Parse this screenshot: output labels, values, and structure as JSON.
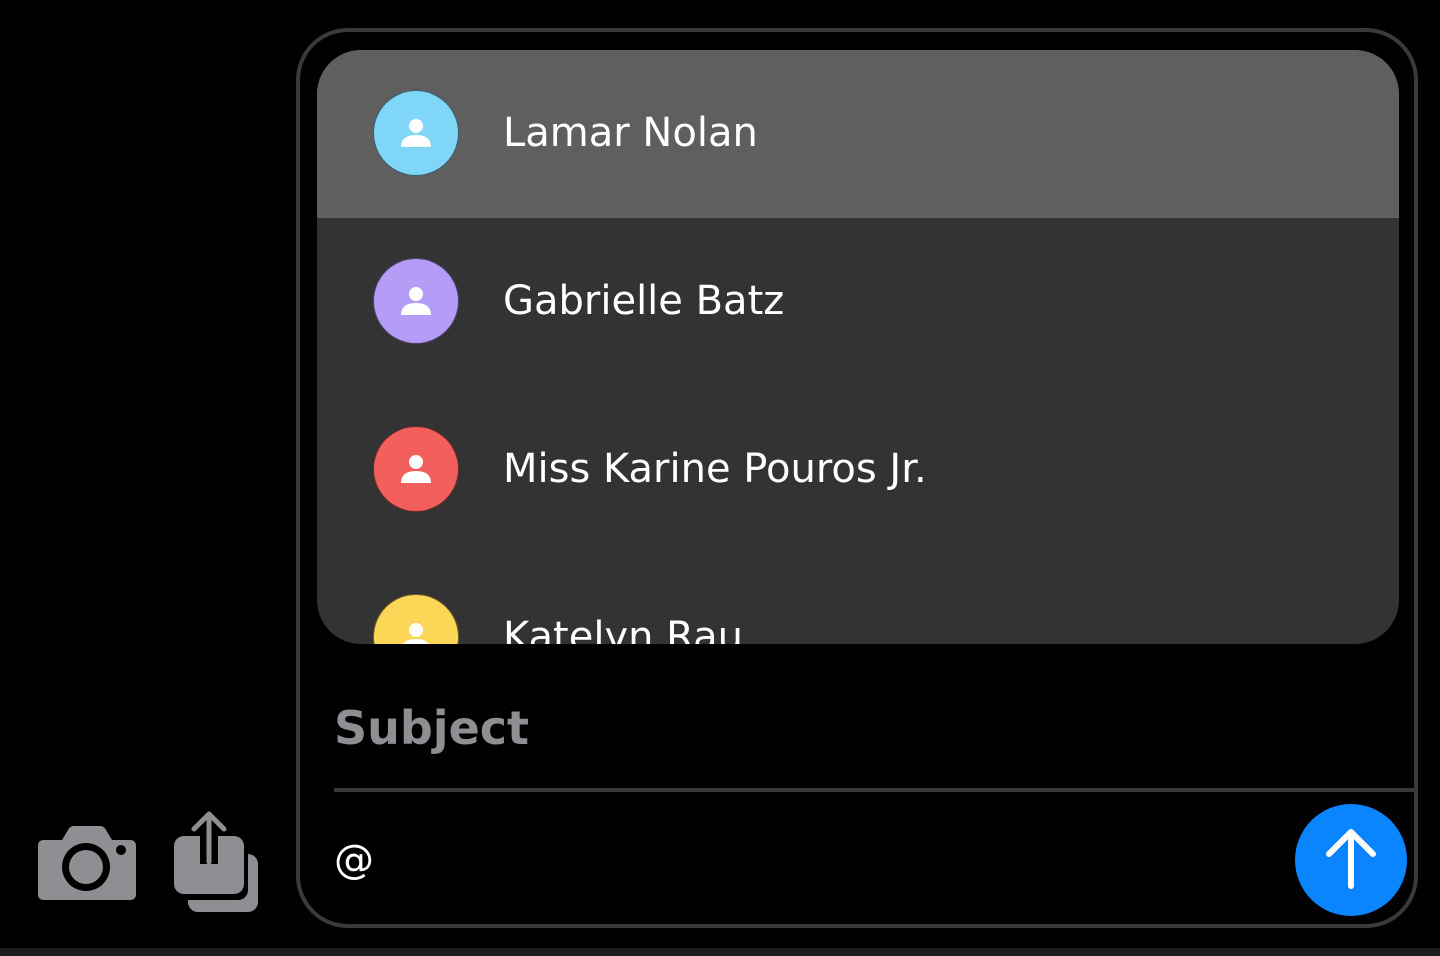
{
  "toolbar": {
    "camera_icon": "camera-icon",
    "share_icon": "share-icon",
    "icon_color": "#8e8e93"
  },
  "mentions": {
    "items": [
      {
        "name": "Lamar Nolan",
        "avatar_color": "#7fd6f7",
        "selected": true
      },
      {
        "name": "Gabrielle Batz",
        "avatar_color": "#b49cf7",
        "selected": false
      },
      {
        "name": "Miss Karine Pouros Jr.",
        "avatar_color": "#f25f5c",
        "selected": false
      },
      {
        "name": "Katelyn Rau",
        "avatar_color": "#fcd757",
        "selected": false
      }
    ]
  },
  "composer": {
    "subject_placeholder": "Subject",
    "message_value": "@",
    "send_icon": "arrow-up-icon",
    "send_color": "#0a84ff"
  }
}
